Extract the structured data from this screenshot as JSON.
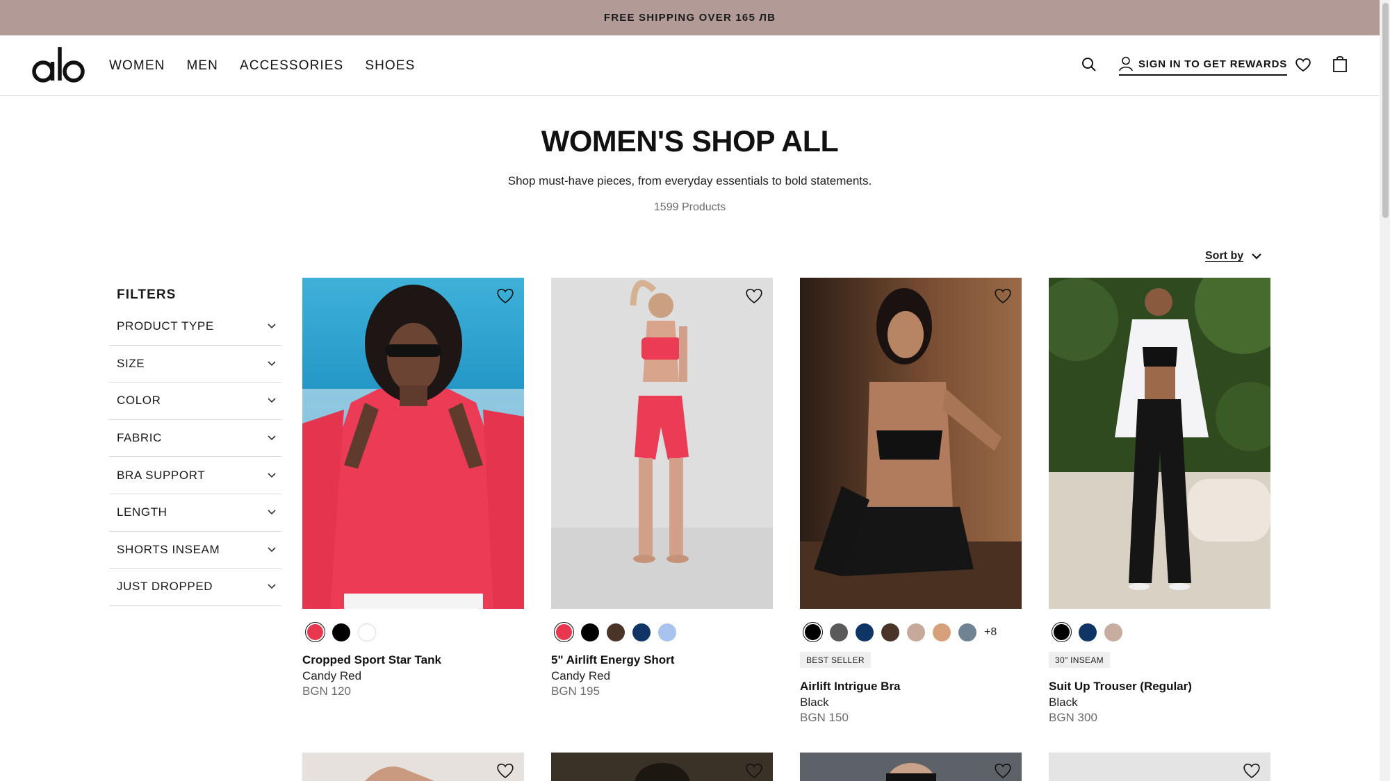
{
  "promo": {
    "text": "FREE SHIPPING OVER 165 ЛВ"
  },
  "header": {
    "logo_alt": "alo",
    "nav": [
      "WOMEN",
      "MEN",
      "ACCESSORIES",
      "SHOES"
    ],
    "signin_label": "SIGN IN TO GET REWARDS",
    "icons": [
      "search-icon",
      "user-icon",
      "heart-icon",
      "bag-icon"
    ]
  },
  "page": {
    "title": "WOMEN'S SHOP ALL",
    "subtitle": "Shop must-have pieces, from everyday essentials to bold statements.",
    "count": "1599 Products",
    "sort_label": "Sort by"
  },
  "filters": {
    "title": "FILTERS",
    "items": [
      "PRODUCT TYPE",
      "SIZE",
      "COLOR",
      "FABRIC",
      "BRA SUPPORT",
      "LENGTH",
      "SHORTS INSEAM",
      "JUST DROPPED"
    ]
  },
  "products": [
    {
      "name": "Cropped Sport Star Tank",
      "color": "Candy Red",
      "price": "BGN 120",
      "badge": "",
      "swatches": [
        "#e8384f",
        "#000000",
        "#ffffff"
      ],
      "more": ""
    },
    {
      "name": "5\" Airlift Energy Short",
      "color": "Candy Red",
      "price": "BGN 195",
      "badge": "",
      "swatches": [
        "#e8384f",
        "#000000",
        "#4a3428",
        "#0f3466",
        "#a9c3ef"
      ],
      "more": ""
    },
    {
      "name": "Airlift Intrigue Bra",
      "color": "Black",
      "price": "BGN 150",
      "badge": "BEST SELLER",
      "swatches": [
        "#000000",
        "#5a5a5a",
        "#0f3466",
        "#4a3428",
        "#c6a99a",
        "#d6a07a",
        "#6f8393"
      ],
      "more": "+8"
    },
    {
      "name": "Suit Up Trouser (Regular)",
      "color": "Black",
      "price": "BGN 300",
      "badge": "30\" INSEAM",
      "swatches": [
        "#000000",
        "#0f3466",
        "#c6ada0"
      ],
      "more": ""
    }
  ],
  "colors": {
    "promo_bg": "#b29a96",
    "accent_red": "#e8384f"
  }
}
